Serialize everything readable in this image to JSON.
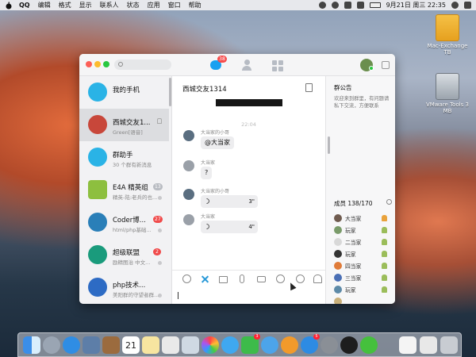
{
  "menubar": {
    "app_name": "QQ",
    "items": [
      "编辑",
      "格式",
      "显示",
      "联系人",
      "状态",
      "应用",
      "窗口",
      "帮助"
    ],
    "clock": "9月21日 周三  22:35"
  },
  "desktop": {
    "icons": [
      {
        "label": "Mac-Exchange TB"
      },
      {
        "label": "VMware Tools 3 MB"
      }
    ]
  },
  "titlebar": {
    "search_placeholder": "",
    "chat_badge": "38"
  },
  "conversations": [
    {
      "name": "我的手机",
      "subtitle": "",
      "badge": "",
      "color": "#2ab3e6"
    },
    {
      "name": "西城交友1...",
      "subtitle": "Green[语音]",
      "badge": "",
      "color": "#c8473a"
    },
    {
      "name": "群助手",
      "subtitle": "30 个群有新消息",
      "badge": "",
      "color": "#2ab3e6"
    },
    {
      "name": "E4A 精英组",
      "subtitle": "精英-陆:老兵的也...",
      "badge": "13",
      "badge_color": "#b9bcc2",
      "color": "#8dbf3f"
    },
    {
      "name": "Coder博...",
      "subtitle": "html/php基础...",
      "badge": "27",
      "badge_color": "#f04b4b",
      "color": "#2a7fb8"
    },
    {
      "name": "超级联盟",
      "subtitle": "励精图治  中文...",
      "badge": "2",
      "badge_color": "#f04b4b",
      "color": "#1a9b7c"
    },
    {
      "name": "php技术...",
      "subtitle": "美阳群的守望者群...",
      "badge": "",
      "color": "#2d6bc4"
    }
  ],
  "chat": {
    "title": "西城交友1314",
    "time": "22:04",
    "messages": [
      {
        "sender": "大当家的小哥",
        "text": "@大当家",
        "type": "text"
      },
      {
        "sender": "大当家",
        "text": "?",
        "type": "text"
      },
      {
        "sender": "大当家的小哥",
        "duration": "3\"",
        "type": "voice"
      },
      {
        "sender": "大当家",
        "duration": "4\"",
        "type": "voice"
      }
    ]
  },
  "announcement": {
    "title": "群公告",
    "text": "欢迎来到群里，有问题请私下交流，方便联系"
  },
  "members": {
    "title": "成员 138/170",
    "list": [
      {
        "name": "大当家",
        "color": "#6f5b4f",
        "icon_color": "#e9a23b"
      },
      {
        "name": "玩家",
        "color": "#7a9b6a",
        "icon_color": "#9bbd5a"
      },
      {
        "name": "二当家",
        "color": "#d8d8d8",
        "icon_color": "#9bbd5a"
      },
      {
        "name": "玩家",
        "color": "#333333",
        "icon_color": "#9bbd5a"
      },
      {
        "name": "四当家",
        "color": "#e07b39",
        "icon_color": "#9bbd5a"
      },
      {
        "name": "三当家",
        "color": "#4a6fb5",
        "icon_color": "#9bbd5a"
      },
      {
        "name": "玩家",
        "color": "#5d8aa8",
        "icon_color": "#9bbd5a"
      },
      {
        "name": "",
        "color": "#c9b07a",
        "icon_color": "#9bbd5a"
      },
      {
        "name": "AAA",
        "color": "#2e6bd1",
        "icon_color": ""
      },
      {
        "name": "",
        "color": "#3f89d8",
        "icon_color": ""
      }
    ]
  },
  "dock": {
    "calendar_day": "21",
    "icons": [
      "finder-icon",
      "launchpad-icon",
      "safari-icon",
      "photos-icon",
      "notes-icon",
      "calendar-icon",
      "reminders-icon",
      "stickies-icon",
      "preview-icon",
      "photo-booth-icon",
      "messages-icon",
      "facetime-icon",
      "itunes-icon",
      "ibooks-icon",
      "app-store-icon",
      "system-preferences-icon",
      "qq-icon",
      "wechat-icon",
      "document-icon",
      "document-icon",
      "trash-icon"
    ],
    "badges": {
      "app-store": "5",
      "facetime": "3"
    }
  }
}
